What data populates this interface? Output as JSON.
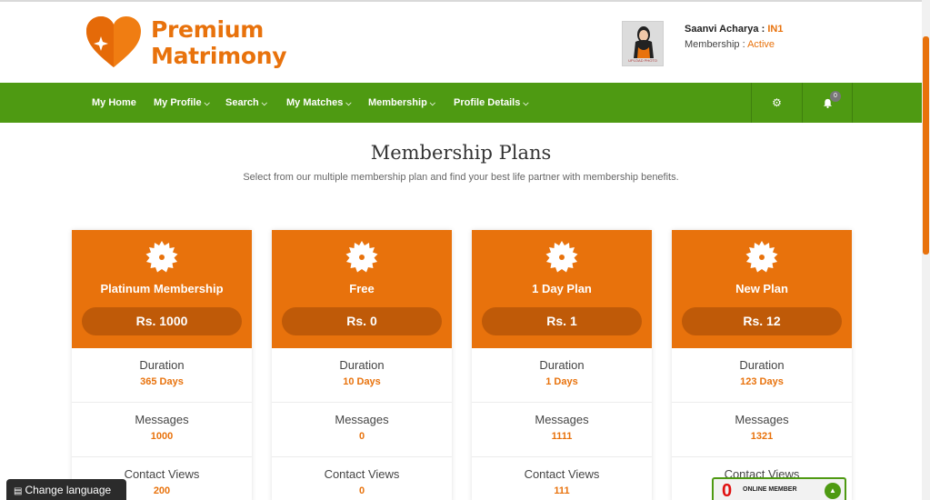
{
  "brand": {
    "line1": "Premium",
    "line2": "Matrimony",
    "color": "#e8720c"
  },
  "user": {
    "photo_caption": "UPLOAD PHOTO",
    "name": "Saanvi Acharya : ",
    "id": "IN1",
    "membership_label": "Membership : ",
    "membership_status": "Active"
  },
  "nav": {
    "color": "#4e9a12",
    "items": [
      {
        "label": "My Home",
        "dropdown": false
      },
      {
        "label": "My Profile",
        "dropdown": true
      },
      {
        "label": "Search",
        "dropdown": true
      },
      {
        "label": "My Matches",
        "dropdown": true
      },
      {
        "label": "Membership",
        "dropdown": true
      },
      {
        "label": "Profile Details",
        "dropdown": true
      }
    ],
    "settings_icon": "gear-icon",
    "notifications_icon": "bell-icon",
    "notification_count": "0"
  },
  "page": {
    "title": "Membership Plans",
    "subtitle": "Select from our multiple membership plan and find your best life partner with membership benefits."
  },
  "feature_labels": {
    "duration": "Duration",
    "messages": "Messages",
    "contact_views": "Contact Views"
  },
  "plans": [
    {
      "name": "Platinum Membership",
      "price": "Rs. 1000",
      "duration": "365 Days",
      "messages": "1000",
      "contact_views": "200"
    },
    {
      "name": "Free",
      "price": "Rs. 0",
      "duration": "10 Days",
      "messages": "0",
      "contact_views": "0"
    },
    {
      "name": "1 Day Plan",
      "price": "Rs. 1",
      "duration": "1 Days",
      "messages": "1111",
      "contact_views": "111"
    },
    {
      "name": "New Plan",
      "price": "Rs. 12",
      "duration": "123 Days",
      "messages": "1321",
      "contact_views": ""
    }
  ],
  "widgets": {
    "change_language": "Change language",
    "online_count": "0",
    "online_label": "ONLINE MEMBER"
  }
}
